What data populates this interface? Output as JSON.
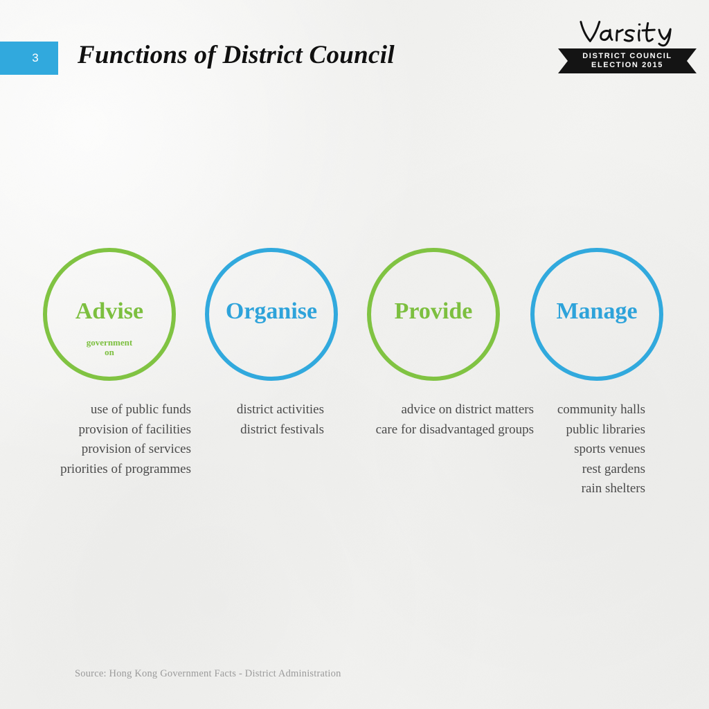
{
  "header": {
    "slide_number": "3",
    "title": "Functions of District Council",
    "accent_blue": "#31a9dd"
  },
  "logo": {
    "wordmark": "Varsity",
    "ribbon_line1": "DISTRICT COUNCIL",
    "ribbon_line2": "ELECTION 2015",
    "ribbon_color": "#141414"
  },
  "colors": {
    "green": "#80c342",
    "blue": "#31a9dd",
    "text_gray": "#4a4a4a",
    "source_gray": "#9b9b9b",
    "background": "#f3f3f1"
  },
  "circles": [
    {
      "label": "Advise",
      "color": "#7cbf3f",
      "ring": "green",
      "sub_line1": "government",
      "sub_line2": "on"
    },
    {
      "label": "Organise",
      "color": "#2ea3da",
      "ring": "blue",
      "sub_line1": "",
      "sub_line2": ""
    },
    {
      "label": "Provide",
      "color": "#7cbf3f",
      "ring": "green",
      "sub_line1": "",
      "sub_line2": ""
    },
    {
      "label": "Manage",
      "color": "#2ea3da",
      "ring": "blue",
      "sub_line1": "",
      "sub_line2": ""
    }
  ],
  "lists": [
    {
      "for": "Advise",
      "items": [
        "use of public funds",
        "provision of facilities",
        "provision of services",
        "priorities of programmes"
      ]
    },
    {
      "for": "Organise",
      "items": [
        "district activities",
        "district festivals"
      ]
    },
    {
      "for": "Provide",
      "items": [
        "advice on district matters",
        "care for disadvantaged groups"
      ]
    },
    {
      "for": "Manage",
      "items": [
        "community halls",
        "public libraries",
        "sports venues",
        "rest gardens",
        "rain shelters"
      ]
    }
  ],
  "source": "Source: Hong Kong Government Facts - District Administration"
}
